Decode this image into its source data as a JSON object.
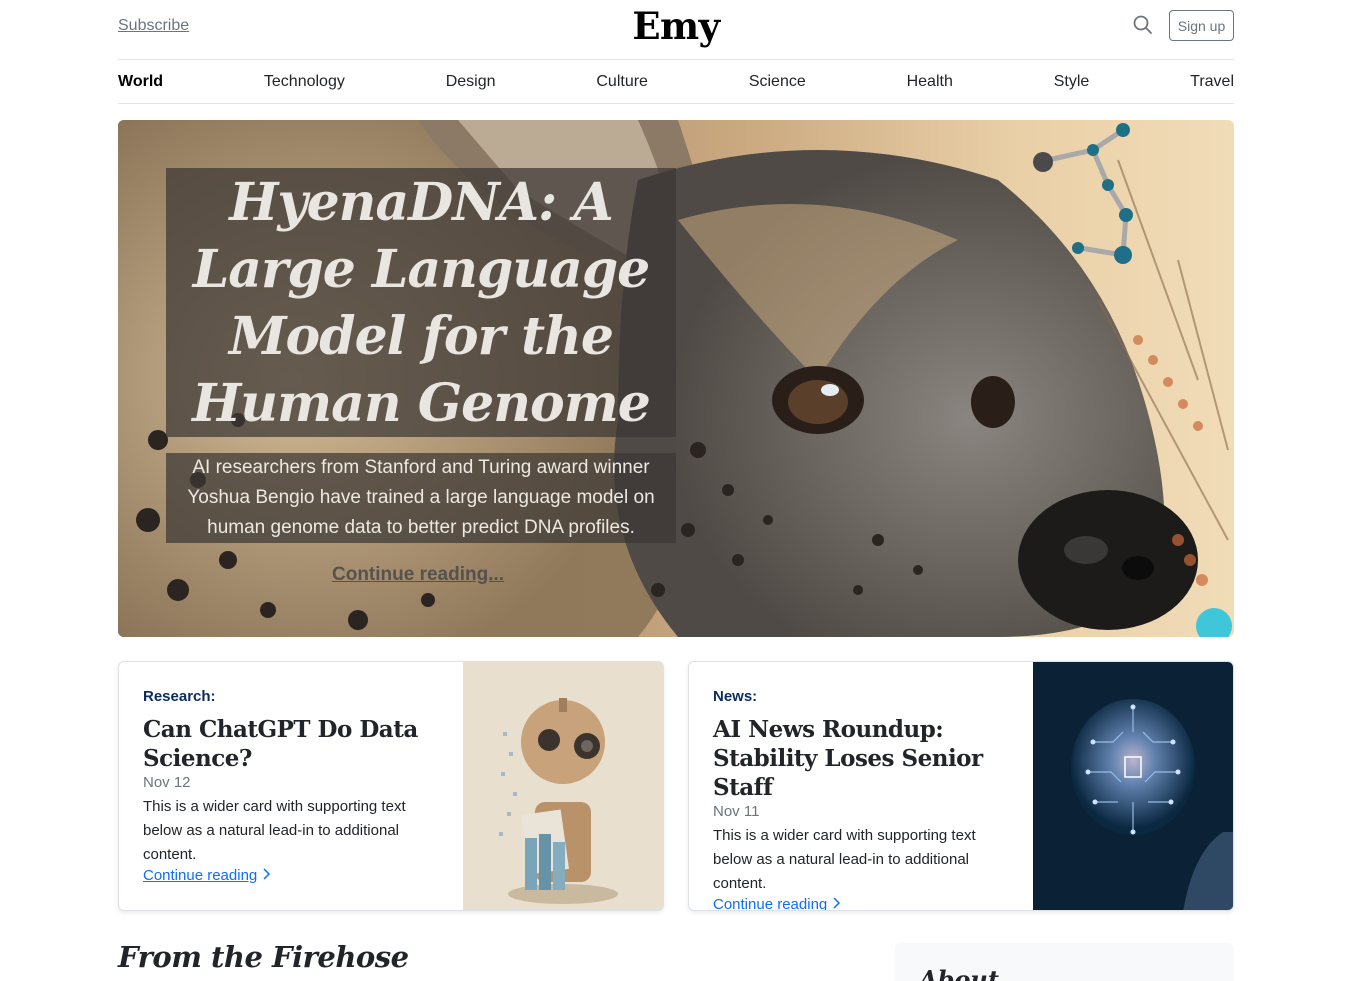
{
  "header": {
    "subscribe_label": "Subscribe",
    "logo": "Emy",
    "signup_label": "Sign up"
  },
  "nav": {
    "items": [
      {
        "label": "World",
        "active": true
      },
      {
        "label": "Technology"
      },
      {
        "label": "Design"
      },
      {
        "label": "Culture"
      },
      {
        "label": "Science"
      },
      {
        "label": "Health"
      },
      {
        "label": "Style"
      },
      {
        "label": "Travel"
      }
    ]
  },
  "hero": {
    "title": "HyenaDNA: A Large Language Model for the Human Genome",
    "lead": "AI researchers from Stanford and Turing award winner Yoshua Bengio have trained a large language model on human genome data to better predict DNA profiles.",
    "link_label": "Continue reading..."
  },
  "cards": [
    {
      "category": "Research:",
      "title": "Can ChatGPT Do Data Science?",
      "date": "Nov 12",
      "text": "This is a wider card with supporting text below as a natural lead-in to additional content.",
      "link_label": "Continue reading"
    },
    {
      "category": "News:",
      "title": "AI News Roundup: Stability Loses Senior Staff",
      "date": "Nov 11",
      "text": "This is a wider card with supporting text below as a natural lead-in to additional content.",
      "link_label": "Continue reading"
    }
  ],
  "firehose": {
    "title": "From the Firehose"
  },
  "sidebar": {
    "about_title": "About"
  },
  "icons": {
    "search": "search-icon",
    "chevron": "chevron-right-icon"
  },
  "colors": {
    "link": "#0d6efd",
    "category": "#0d2b5e",
    "muted": "#6c757d"
  }
}
